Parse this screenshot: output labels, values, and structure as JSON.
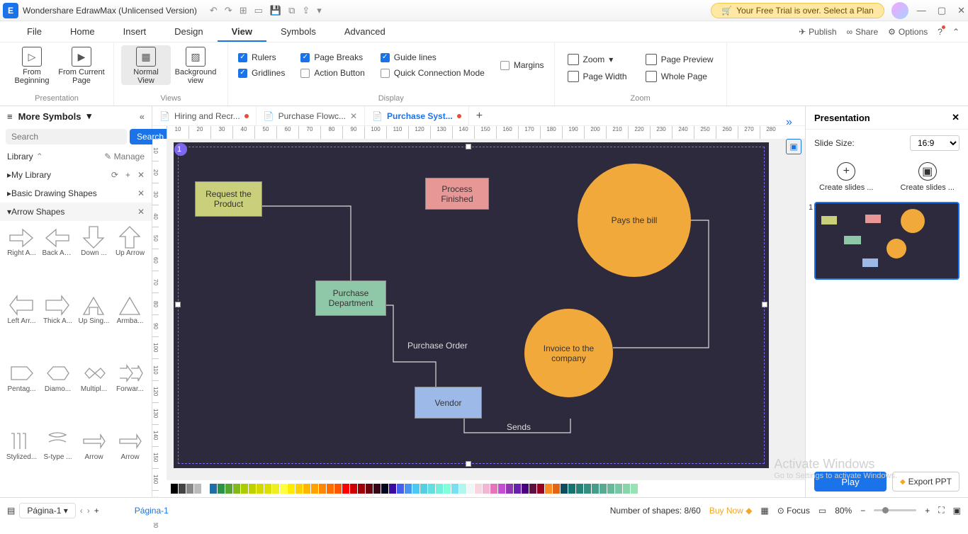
{
  "app_title": "Wondershare EdrawMax (Unlicensed Version)",
  "trial_msg": "Your Free Trial is over. Select a Plan",
  "menus": [
    "File",
    "Home",
    "Insert",
    "Design",
    "View",
    "Symbols",
    "Advanced"
  ],
  "active_menu": "View",
  "right_menu": {
    "publish": "Publish",
    "share": "Share",
    "options": "Options"
  },
  "ribbon": {
    "presentation": {
      "label": "Presentation",
      "from_beginning": "From\nBeginning",
      "from_current": "From Current\nPage"
    },
    "views": {
      "label": "Views",
      "normal": "Normal\nView",
      "background": "Background\nview"
    },
    "display": {
      "label": "Display",
      "rulers": "Rulers",
      "page_breaks": "Page Breaks",
      "guide_lines": "Guide lines",
      "margins": "Margins",
      "gridlines": "Gridlines",
      "action_button": "Action Button",
      "quick_conn": "Quick Connection Mode"
    },
    "zoom": {
      "label": "Zoom",
      "zoom": "Zoom",
      "page_preview": "Page Preview",
      "page_width": "Page Width",
      "whole_page": "Whole Page"
    }
  },
  "left": {
    "title": "More Symbols",
    "search_ph": "Search",
    "search_btn": "Search",
    "library": "Library",
    "manage": "Manage",
    "my_library": "My Library",
    "basic": "Basic Drawing Shapes",
    "arrows": "Arrow Shapes",
    "shapes": [
      "Right A...",
      "Back Arr...",
      "Down ...",
      "Up Arrow",
      "Left Arr...",
      "Thick A...",
      "Up Sing...",
      "Armba...",
      "Pentag...",
      "Diamo...",
      "Multipl...",
      "Forwar...",
      "Stylized...",
      "S-type ...",
      "Arrow",
      "Arrow"
    ]
  },
  "doc_tabs": [
    {
      "name": "Hiring and Recr...",
      "dirty": true,
      "active": false
    },
    {
      "name": "Purchase Flowc...",
      "dirty": false,
      "active": false
    },
    {
      "name": "Purchase Syst...",
      "dirty": true,
      "active": true
    }
  ],
  "nodes": {
    "request": "Request the\nProduct",
    "process": "Process\nFinished",
    "pays": "Pays the bill",
    "purchase": "Purchase\nDepartment",
    "invoice": "Invoice to the\ncompany",
    "vendor": "Vendor",
    "po": "Purchase\nOrder",
    "sends": "Sends"
  },
  "right_panel": {
    "title": "Presentation",
    "slide_size": "Slide Size:",
    "ratio": "16:9",
    "create1": "Create slides ...",
    "create2": "Create slides ...",
    "play": "Play",
    "export": "Export PPT"
  },
  "status": {
    "page_sel": "Página-1",
    "page_link": "Página-1",
    "shapes": "Number of shapes: 8/60",
    "buy": "Buy Now",
    "focus": "Focus",
    "zoom": "80%"
  },
  "watermark1": "Activate Windows",
  "watermark2": "Go to Settings to activate Windows.",
  "colors": [
    "#000",
    "#444",
    "#888",
    "#bbb",
    "#fff",
    "#1d6fa5",
    "#2b9348",
    "#55a630",
    "#80b918",
    "#aacc00",
    "#bfd200",
    "#d4d700",
    "#dddf00",
    "#eeef20",
    "#ffff3f",
    "#ffea00",
    "#ffd000",
    "#ffb700",
    "#ffa200",
    "#ff8800",
    "#ff6d00",
    "#ff5400",
    "#ff0000",
    "#d00000",
    "#9d0208",
    "#6a040f",
    "#370617",
    "#03071e",
    "#3a0ca3",
    "#4361ee",
    "#4895ef",
    "#4cc9f0",
    "#56cfe1",
    "#64dfdf",
    "#72efdd",
    "#80ffdb",
    "#7bdff2",
    "#b2f7ef",
    "#eff7f6",
    "#f7d6e0",
    "#f2b5d4",
    "#e574bc",
    "#c44fd1",
    "#9336b4",
    "#6622aa",
    "#4b0082",
    "#5f0f40",
    "#9a031e",
    "#fb8b24",
    "#e36414",
    "#0f4c5c",
    "#14746f",
    "#248277",
    "#358f80",
    "#469d89",
    "#56ab91",
    "#67b99a",
    "#78c6a3",
    "#88d4ab",
    "#99e2b4"
  ]
}
